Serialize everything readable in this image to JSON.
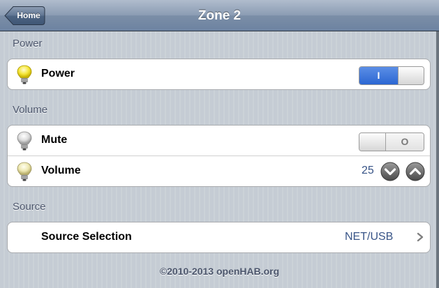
{
  "header": {
    "title": "Zone 2",
    "back_label": "Home"
  },
  "groups": [
    {
      "header": "Power",
      "rows": [
        {
          "label": "Power",
          "icon": "lightbulb-on-icon",
          "control": "switch",
          "state": "on",
          "on_text": "I"
        }
      ]
    },
    {
      "header": "Volume",
      "rows": [
        {
          "label": "Mute",
          "icon": "lightbulb-off-icon",
          "control": "switch",
          "state": "off",
          "off_text": "O"
        },
        {
          "label": "Volume",
          "icon": "lightbulb-dim-icon",
          "control": "setpoint",
          "value": "25"
        }
      ]
    },
    {
      "header": "Source",
      "rows": [
        {
          "label": "Source Selection",
          "control": "selection",
          "value": "NET/USB"
        }
      ]
    }
  ],
  "footer": {
    "copyright": "©2010-2013 openHAB.org"
  },
  "colors": {
    "accent_blue": "#2c67d2",
    "value_text": "#385487",
    "group_header_text": "#4c566c"
  }
}
